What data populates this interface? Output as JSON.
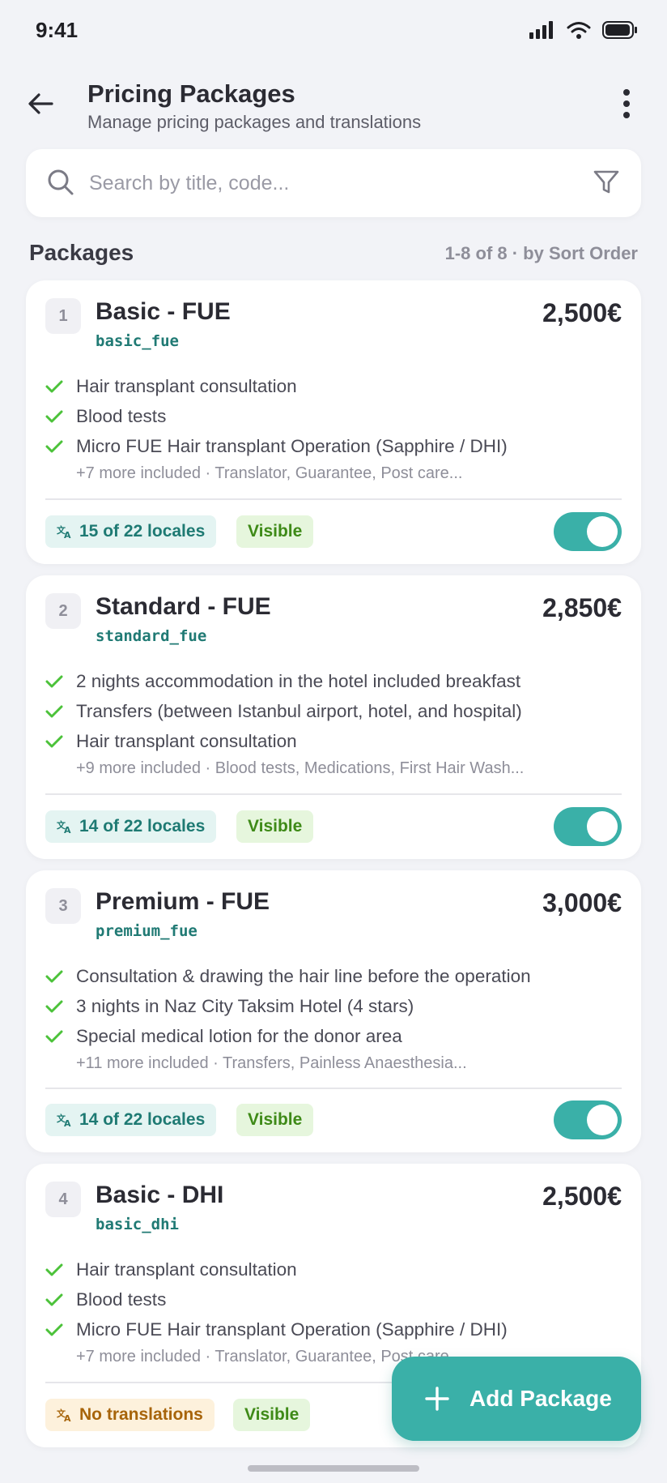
{
  "status": {
    "time": "9:41"
  },
  "header": {
    "title": "Pricing Packages",
    "subtitle": "Manage pricing packages and translations"
  },
  "search": {
    "placeholder": "Search by title, code..."
  },
  "section": {
    "title": "Packages",
    "meta": "1-8 of 8 · by Sort Order"
  },
  "packages": [
    {
      "rank": "1",
      "title": "Basic - FUE",
      "code": "basic_fue",
      "price": "2,500€",
      "features": [
        "Hair transplant consultation",
        "Blood tests",
        "Micro FUE Hair transplant Operation (Sapphire / DHI)"
      ],
      "more": "+7 more included · Translator, Guarantee, Post care...",
      "locales": "15 of 22 locales",
      "visibility": "Visible",
      "enabled": true
    },
    {
      "rank": "2",
      "title": "Standard - FUE",
      "code": "standard_fue",
      "price": "2,850€",
      "features": [
        "2 nights accommodation in the hotel included breakfast",
        "Transfers (between Istanbul airport, hotel, and hospital)",
        "Hair transplant consultation"
      ],
      "more": "+9 more included · Blood tests, Medications, First Hair Wash...",
      "locales": "14 of 22 locales",
      "visibility": "Visible",
      "enabled": true
    },
    {
      "rank": "3",
      "title": "Premium - FUE",
      "code": "premium_fue",
      "price": "3,000€",
      "features": [
        "Consultation & drawing the hair line before the operation",
        "3 nights in Naz City Taksim Hotel (4 stars)",
        "Special medical lotion for the donor area"
      ],
      "more": "+11 more included · Transfers, Painless Anaesthesia...",
      "locales": "14 of 22 locales",
      "visibility": "Visible",
      "enabled": true
    },
    {
      "rank": "4",
      "title": "Basic - DHI",
      "code": "basic_dhi",
      "price": "2,500€",
      "features": [
        "Hair transplant consultation",
        "Blood tests",
        "Micro FUE Hair transplant Operation (Sapphire / DHI)"
      ],
      "more": "+7 more included · Translator, Guarantee, Post care...",
      "locales": "No translations",
      "visibility": "Visible",
      "enabled": true
    }
  ],
  "fab": {
    "label": "Add Package"
  },
  "colors": {
    "accent": "#3ab0a8",
    "code": "#207a74",
    "check": "#4cc23a",
    "visible_bg": "#e6f6dd",
    "warn_bg": "#fdf1dc"
  },
  "icons": {
    "back": "arrow-left-icon",
    "more": "more-vertical-icon",
    "search": "search-icon",
    "filter": "filter-icon",
    "translate": "translate-icon",
    "check": "check-icon",
    "plus": "plus-icon"
  }
}
